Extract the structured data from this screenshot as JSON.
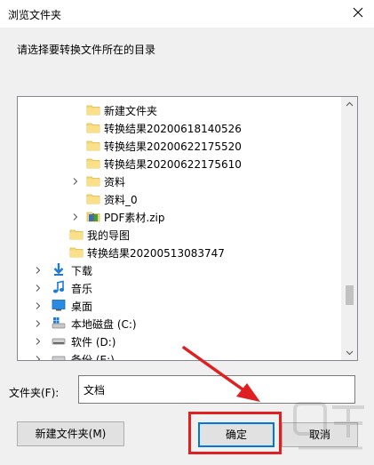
{
  "window": {
    "title": "浏览文件夹"
  },
  "dialog": {
    "instruction": "请选择要转换文件所在的目录"
  },
  "tree": {
    "items": [
      {
        "label": "新建文件夹",
        "icon": "folder-icon",
        "depth": 3,
        "expandable": false
      },
      {
        "label": "转换结果20200618140526",
        "icon": "folder-icon",
        "depth": 3,
        "expandable": false
      },
      {
        "label": "转换结果20200622175520",
        "icon": "folder-icon",
        "depth": 3,
        "expandable": false
      },
      {
        "label": "转换结果20200622175610",
        "icon": "folder-icon",
        "depth": 3,
        "expandable": false
      },
      {
        "label": "资料",
        "icon": "folder-icon",
        "depth": 3,
        "expandable": true
      },
      {
        "label": "资料_0",
        "icon": "folder-icon",
        "depth": 3,
        "expandable": false
      },
      {
        "label": "PDF素材.zip",
        "icon": "zip-archive-icon",
        "depth": 3,
        "expandable": true
      },
      {
        "label": "我的导图",
        "icon": "folder-icon",
        "depth": 2,
        "expandable": false
      },
      {
        "label": "转换结果20200513083747",
        "icon": "folder-icon",
        "depth": 2,
        "expandable": false
      },
      {
        "label": "下载",
        "icon": "download-icon",
        "depth": 1,
        "expandable": true
      },
      {
        "label": "音乐",
        "icon": "music-icon",
        "depth": 1,
        "expandable": true
      },
      {
        "label": "桌面",
        "icon": "desktop-icon",
        "depth": 1,
        "expandable": true
      },
      {
        "label": "本地磁盘 (C:)",
        "icon": "windows-drive-icon",
        "depth": 1,
        "expandable": true
      },
      {
        "label": "软件 (D:)",
        "icon": "drive-icon",
        "depth": 1,
        "expandable": true
      },
      {
        "label": "备份 (E:)",
        "icon": "drive-icon",
        "depth": 1,
        "expandable": true
      }
    ]
  },
  "folder": {
    "label": "文件夹(F):",
    "value": "文档"
  },
  "buttons": {
    "new_folder": "新建文件夹(M)",
    "ok": "确定",
    "cancel": "取消"
  },
  "colors": {
    "accent": "#0078d7",
    "annotation": "#e02020",
    "folder": "#f8d775"
  }
}
